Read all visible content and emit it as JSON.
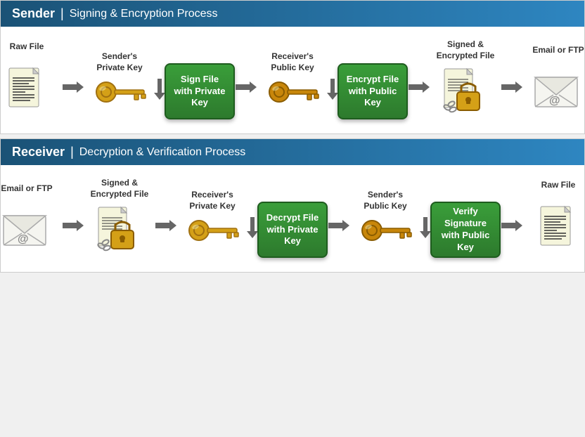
{
  "sender_section": {
    "title": "Sender",
    "separator": "|",
    "subtitle": "Signing & Encryption Process",
    "items": [
      {
        "id": "raw-file",
        "label": "Raw File",
        "type": "document"
      },
      {
        "id": "sender-private-key",
        "label": "Sender's\nPrivate Key",
        "type": "key-gold"
      },
      {
        "id": "sign-action",
        "label": "Sign File\nwith\nPrivate Key",
        "type": "action"
      },
      {
        "id": "receiver-public-key",
        "label": "Receiver's\nPublic Key",
        "type": "key-gold"
      },
      {
        "id": "encrypt-action",
        "label": "Encrypt File\nwith\nPublic Key",
        "type": "action"
      },
      {
        "id": "signed-encrypted-file",
        "label": "Signed &\nEncrypted File",
        "type": "locked-doc"
      },
      {
        "id": "email-ftp",
        "label": "Email or FTP",
        "type": "email"
      }
    ]
  },
  "receiver_section": {
    "title": "Receiver",
    "separator": "|",
    "subtitle": "Decryption & Verification Process",
    "items": [
      {
        "id": "email-ftp-recv",
        "label": "Email or FTP",
        "type": "email"
      },
      {
        "id": "signed-encrypted-recv",
        "label": "Signed &\nEncrypted File",
        "type": "locked-doc"
      },
      {
        "id": "receiver-private-key",
        "label": "Receiver's\nPrivate Key",
        "type": "key-gold"
      },
      {
        "id": "decrypt-action",
        "label": "Decrypt File\nwith\nPrivate Key",
        "type": "action"
      },
      {
        "id": "sender-public-key",
        "label": "Sender's\nPublic Key",
        "type": "key-gold"
      },
      {
        "id": "verify-action",
        "label": "Verify\nSignature with\nPublic Key",
        "type": "action"
      },
      {
        "id": "raw-file-recv",
        "label": "Raw File",
        "type": "document"
      }
    ]
  },
  "colors": {
    "header_bg": "#1a5276",
    "action_green": "#2d8a2d",
    "key_gold": "#d4a017",
    "arrow_color": "#555555"
  }
}
